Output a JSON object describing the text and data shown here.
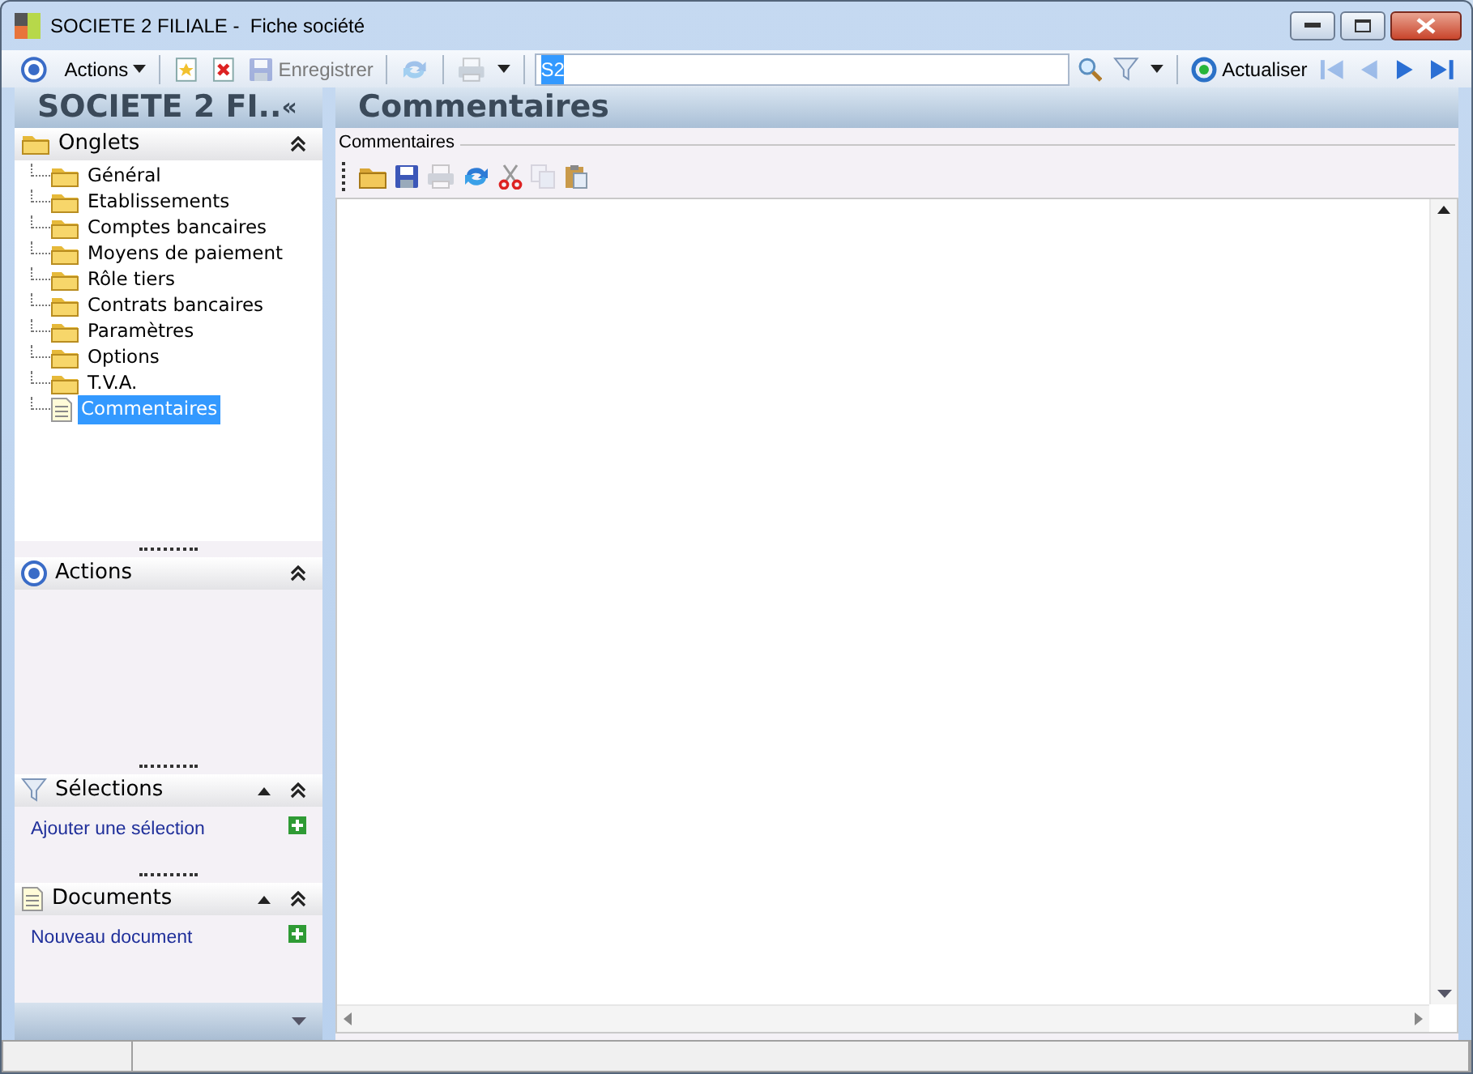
{
  "window": {
    "title": "SOCIETE 2 FILIALE -  Fiche société"
  },
  "toolbar": [
    {
      "kind": "target"
    },
    {
      "kind": "menu",
      "label": "Actions"
    },
    {
      "kind": "sep"
    },
    {
      "kind": "new",
      "disabled": false
    },
    {
      "kind": "delete",
      "disabled": false
    },
    {
      "kind": "save",
      "label": "Enregistrer",
      "disabled": true
    },
    {
      "kind": "sep"
    },
    {
      "kind": "refresh",
      "disabled": true
    },
    {
      "kind": "sep"
    },
    {
      "kind": "print",
      "disabled": true
    },
    {
      "kind": "caret"
    },
    {
      "kind": "sep"
    },
    {
      "kind": "search",
      "value": "S2"
    },
    {
      "kind": "find"
    },
    {
      "kind": "filter"
    },
    {
      "kind": "caret"
    },
    {
      "kind": "sep"
    },
    {
      "kind": "reload",
      "label": "Actualiser"
    },
    {
      "kind": "first",
      "disabled": true
    },
    {
      "kind": "prev",
      "disabled": true
    },
    {
      "kind": "next",
      "disabled": false
    },
    {
      "kind": "last",
      "disabled": false
    }
  ],
  "sidebar": {
    "title": "SOCIETE 2 FI..",
    "collapse_glyph": "«",
    "panels": [
      {
        "kind": "tree",
        "title": "Onglets",
        "items": [
          {
            "label": "Général",
            "kind": "folder",
            "selected": false
          },
          {
            "label": "Etablissements",
            "kind": "folder",
            "selected": false
          },
          {
            "label": "Comptes bancaires",
            "kind": "folder",
            "selected": false
          },
          {
            "label": "Moyens de paiement",
            "kind": "folder",
            "selected": false
          },
          {
            "label": "Rôle tiers",
            "kind": "folder",
            "selected": false
          },
          {
            "label": "Contrats bancaires",
            "kind": "folder",
            "selected": false
          },
          {
            "label": "Paramètres",
            "kind": "folder",
            "selected": false
          },
          {
            "label": "Options",
            "kind": "folder",
            "selected": false
          },
          {
            "label": "T.V.A.",
            "kind": "folder",
            "selected": false
          },
          {
            "label": "Commentaires",
            "kind": "document",
            "selected": true
          }
        ]
      },
      {
        "kind": "actions",
        "title": "Actions"
      },
      {
        "kind": "selections",
        "title": "Sélections",
        "link": "Ajouter une sélection"
      },
      {
        "kind": "documents",
        "title": "Documents",
        "link": "Nouveau document"
      }
    ]
  },
  "content": {
    "title": "Commentaires",
    "group_label": "Commentaires",
    "editor_toolbar": [
      {
        "kind": "open",
        "disabled": false
      },
      {
        "kind": "save",
        "disabled": false
      },
      {
        "kind": "print",
        "disabled": true
      },
      {
        "kind": "refresh",
        "disabled": false
      },
      {
        "kind": "cut",
        "disabled": false
      },
      {
        "kind": "copy",
        "disabled": true
      },
      {
        "kind": "paste",
        "disabled": false
      }
    ]
  }
}
